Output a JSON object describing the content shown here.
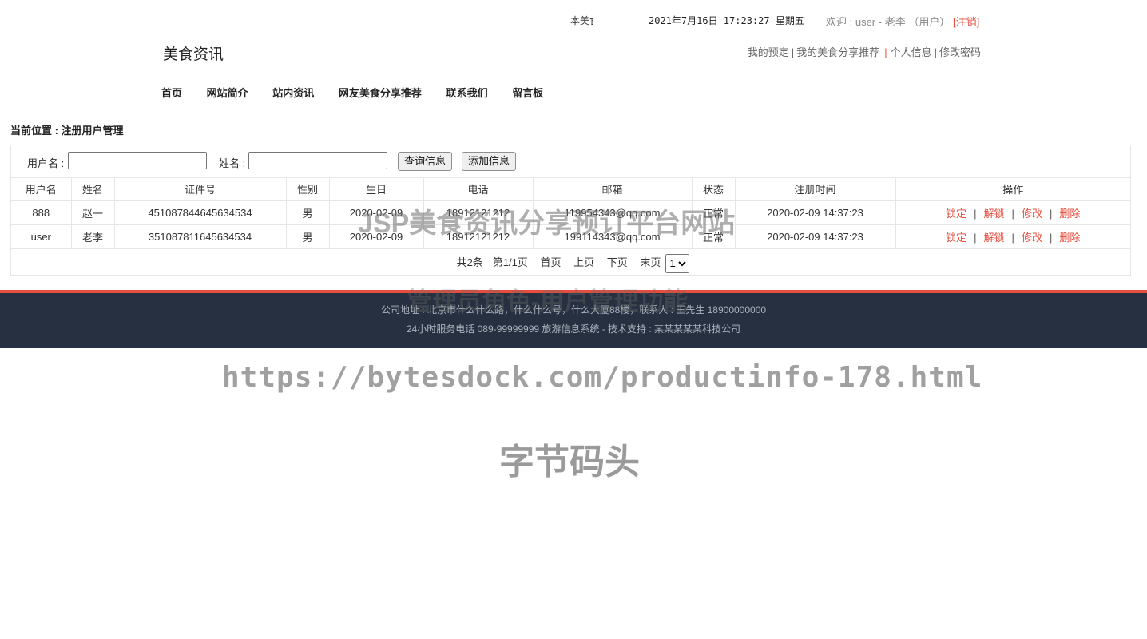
{
  "topbar": {
    "marquee": "本美食资讯分享预订平台",
    "datetime": "2021年7月16日  17:23:27  星期五",
    "welcome_prefix": "欢迎 : ",
    "username": "user",
    "dash": " - ",
    "realname": "老李",
    "role": " （用户） ",
    "logout": "[注销]"
  },
  "header": {
    "site_title": "美食资讯",
    "quicklinks": [
      "我的预定",
      "我的美食分享推荐",
      "个人信息",
      "修改密码"
    ]
  },
  "nav": [
    "首页",
    "网站简介",
    "站内资讯",
    "网友美食分享推荐",
    "联系我们",
    "留言板"
  ],
  "breadcrumb": "当前位置 : 注册用户管理",
  "search": {
    "username_label": "用户名 :",
    "username_value": "",
    "name_label": "姓名 :",
    "name_value": "",
    "query_button": "查询信息",
    "add_button": "添加信息"
  },
  "table": {
    "columns": [
      "用户名",
      "姓名",
      "证件号",
      "性别",
      "生日",
      "电话",
      "邮箱",
      "状态",
      "注册时间",
      "操作"
    ],
    "rows": [
      [
        "888",
        "赵一",
        "451087844645634534",
        "男",
        "2020-02-09",
        "18912121212",
        "119954343@qq.com",
        "正常",
        "2020-02-09 14:37:23"
      ],
      [
        "user",
        "老李",
        "351087811645634534",
        "男",
        "2020-02-09",
        "18912121212",
        "199114343@qq.com",
        "正常",
        "2020-02-09 14:37:23"
      ]
    ],
    "actions": [
      "锁定",
      "解锁",
      "修改",
      "删除"
    ],
    "action_separator": "|"
  },
  "pager": {
    "total": "共2条",
    "page_info": "第1/1页",
    "first": "首页",
    "prev": "上页",
    "next": "下页",
    "last": "末页",
    "selected_page": "1"
  },
  "footer": {
    "line1": "公司地址 : 北京市什么什么路，什么什么号，什么大厦88楼，联系人 : 王先生 18900000000",
    "line2": "24小时服务电话   089-99999999   旅游信息系统 - 技术支持 : 某某某某某科技公司"
  },
  "watermarks": {
    "title": "JSP美食资讯分享预订平台网站",
    "subtitle": "管理员角色-用户管理功能",
    "url": "https://bytesdock.com/productinfo-178.html",
    "brand": "字节码头"
  },
  "colors": {
    "accent_red": "#e74c3c",
    "footer_bg": "#263040"
  }
}
